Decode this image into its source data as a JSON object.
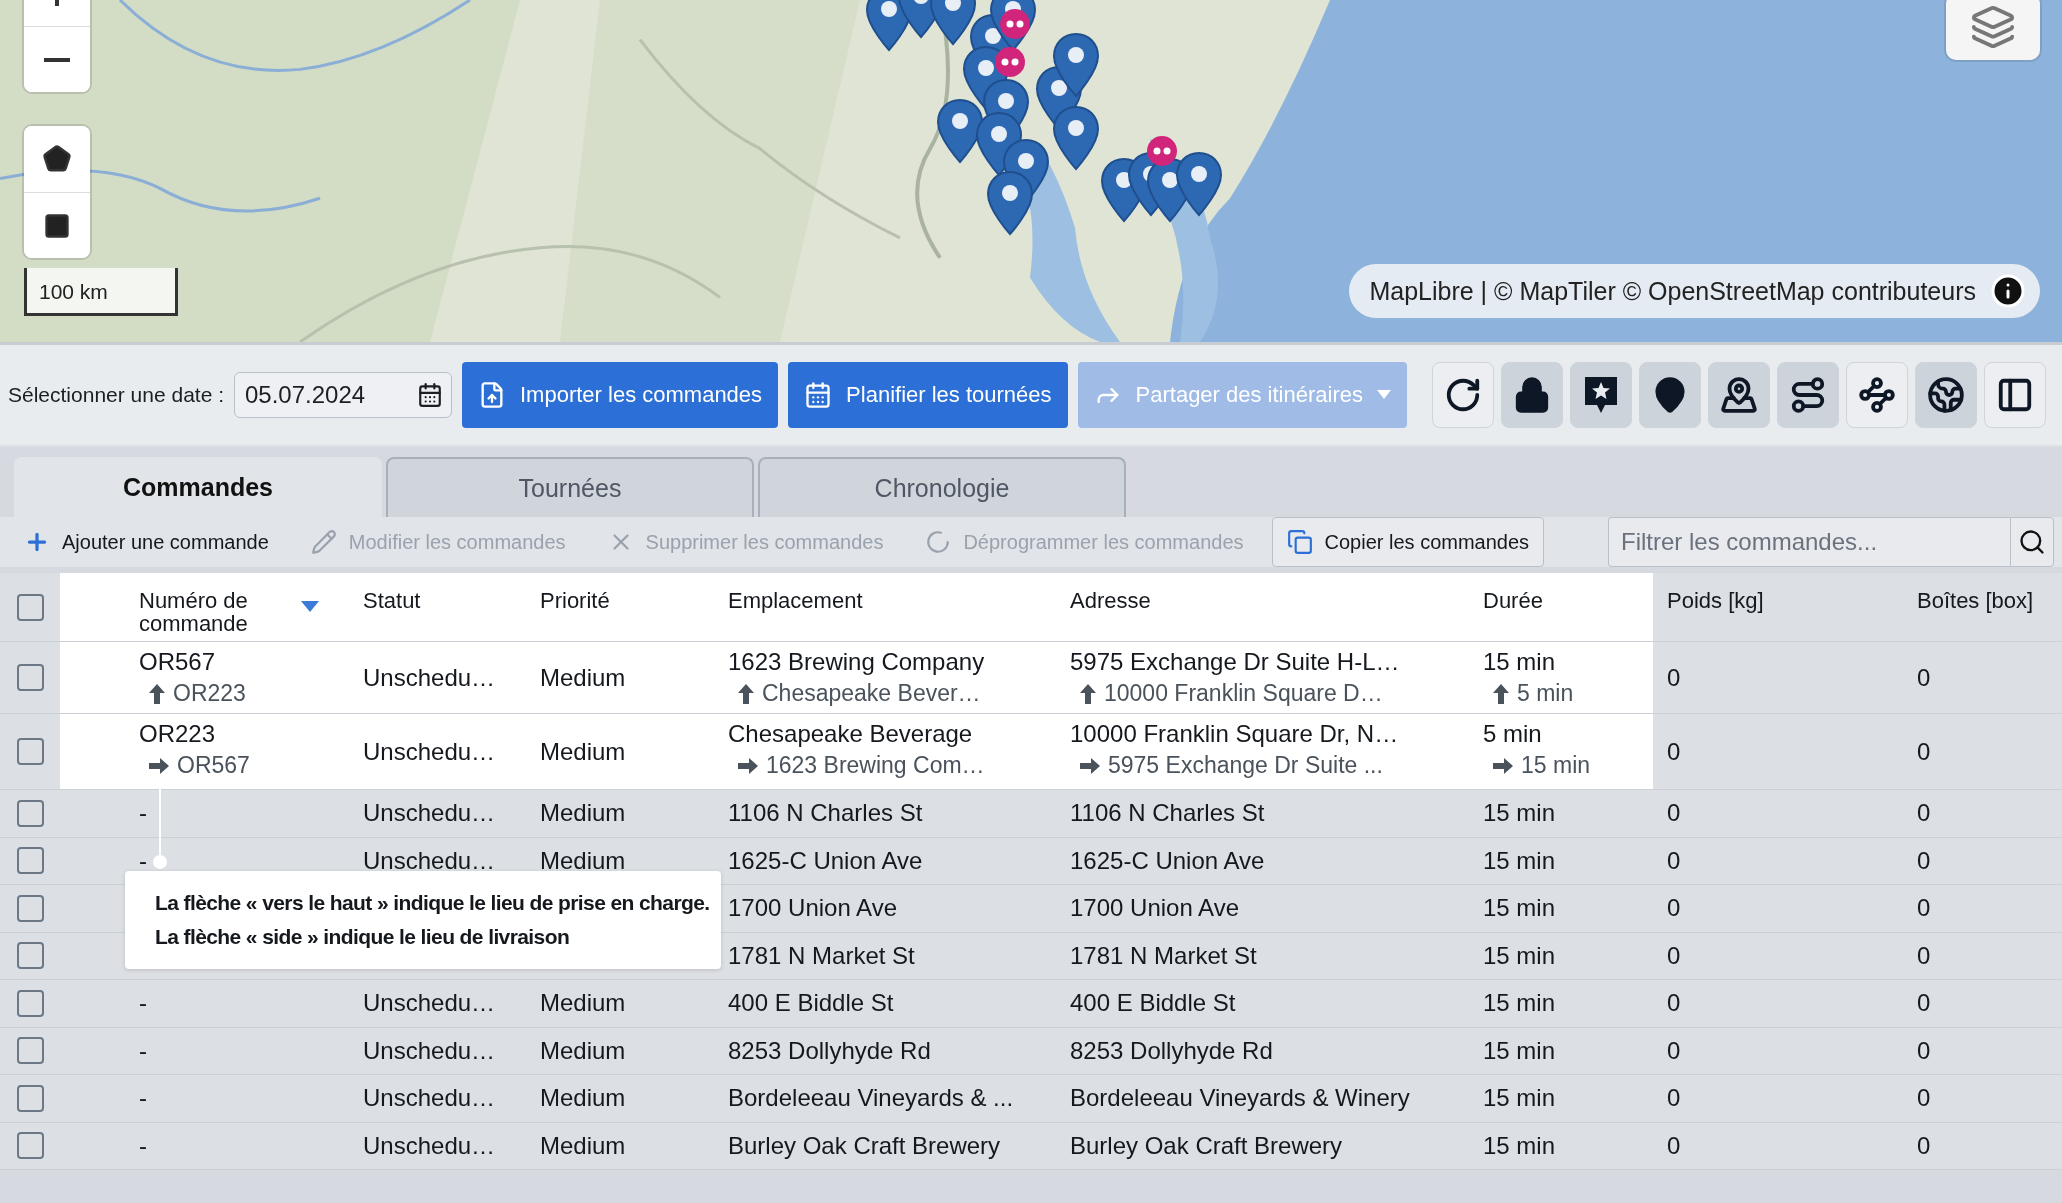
{
  "map": {
    "kind": "picture",
    "scale": "100 km",
    "attribution": "MapLibre | © MapTiler © OpenStreetMap contributeurs"
  },
  "toolbar": {
    "date_label": "Sélectionner une date :",
    "date_value": "05.07.2024",
    "buttons": [
      {
        "kind": "import",
        "label": "Importer les commandes",
        "disabled": false
      },
      {
        "kind": "plan",
        "label": "Planifier les tournées",
        "disabled": false
      },
      {
        "kind": "share",
        "label": "Partager des itinéraires",
        "disabled": true
      }
    ],
    "icon_buttons": [
      {
        "kind": "refresh",
        "active": false
      },
      {
        "kind": "lock",
        "active": true
      },
      {
        "kind": "star-bubble",
        "active": true
      },
      {
        "kind": "pin",
        "active": true
      },
      {
        "kind": "pin-base",
        "active": true
      },
      {
        "kind": "route",
        "active": true
      },
      {
        "kind": "branches",
        "active": false
      },
      {
        "kind": "globe",
        "active": true
      },
      {
        "kind": "panel",
        "active": false
      }
    ]
  },
  "tabs": [
    {
      "label": "Commandes",
      "selected": true
    },
    {
      "label": "Tournées",
      "selected": false
    },
    {
      "label": "Chronologie",
      "selected": false
    }
  ],
  "actions": [
    {
      "kind": "add",
      "label": "Ajouter une commande",
      "disabled": false
    },
    {
      "kind": "edit",
      "label": "Modifier les commandes",
      "disabled": true
    },
    {
      "kind": "delete",
      "label": "Supprimer les commandes",
      "disabled": true
    },
    {
      "kind": "unschedule",
      "label": "Déprogrammer les commandes",
      "disabled": true
    },
    {
      "kind": "copy",
      "label": "Copier les commandes",
      "disabled": false
    }
  ],
  "filter": {
    "placeholder": "Filtrer les commandes..."
  },
  "table": {
    "header_checked": false,
    "header_highlighted": true,
    "columns": [
      {
        "label": "Numéro de commande",
        "sorted": true
      },
      {
        "label": "Statut",
        "sorted": false
      },
      {
        "label": "Priorité",
        "sorted": false
      },
      {
        "label": "Emplacement",
        "sorted": false
      },
      {
        "label": "Adresse",
        "sorted": false
      },
      {
        "label": "Durée",
        "sorted": false
      },
      {
        "label": "Poids [kg]",
        "sorted": false
      },
      {
        "label": "Boîtes [box]",
        "sorted": false
      }
    ],
    "rows": [
      {
        "checked": false,
        "highlighted": true,
        "number": {
          "text": "OR567",
          "sub": {
            "kind": "up",
            "text": "OR223"
          }
        },
        "status": {
          "text": "Unschedu…"
        },
        "priority": {
          "text": "Medium"
        },
        "location": {
          "text": "1623 Brewing Company",
          "sub": {
            "kind": "up",
            "text": "Chesapeake Bever…"
          }
        },
        "address": {
          "text": "5975 Exchange Dr Suite H-L…",
          "sub": {
            "kind": "up",
            "text": "10000 Franklin Square D…"
          }
        },
        "duration": {
          "text": "15 min",
          "sub": {
            "kind": "up",
            "text": "5 min"
          }
        },
        "weight": {
          "text": "0"
        },
        "boxes": {
          "text": "0"
        }
      },
      {
        "checked": false,
        "highlighted": true,
        "number": {
          "text": "OR223",
          "sub": {
            "kind": "side",
            "text": "OR567"
          }
        },
        "status": {
          "text": "Unschedu…"
        },
        "priority": {
          "text": "Medium"
        },
        "location": {
          "text": "Chesapeake Beverage",
          "sub": {
            "kind": "side",
            "text": "1623 Brewing Com…"
          }
        },
        "address": {
          "text": "10000 Franklin Square Dr, N…",
          "sub": {
            "kind": "side",
            "text": "5975 Exchange Dr Suite ..."
          }
        },
        "duration": {
          "text": "5 min",
          "sub": {
            "kind": "side",
            "text": "15 min"
          }
        },
        "weight": {
          "text": "0"
        },
        "boxes": {
          "text": "0"
        }
      },
      {
        "checked": false,
        "highlighted": false,
        "number": {
          "text": "-"
        },
        "status": {
          "text": "Unschedu…"
        },
        "priority": {
          "text": "Medium"
        },
        "location": {
          "text": "1106 N Charles St"
        },
        "address": {
          "text": "1106 N Charles St"
        },
        "duration": {
          "text": "15 min"
        },
        "weight": {
          "text": "0"
        },
        "boxes": {
          "text": "0"
        }
      },
      {
        "checked": false,
        "highlighted": false,
        "number": {
          "text": "-"
        },
        "status": {
          "text": "Unschedu…"
        },
        "priority": {
          "text": "Medium"
        },
        "location": {
          "text": "1625-C Union Ave"
        },
        "address": {
          "text": "1625-C Union Ave"
        },
        "duration": {
          "text": "15 min"
        },
        "weight": {
          "text": "0"
        },
        "boxes": {
          "text": "0"
        }
      },
      {
        "checked": false,
        "highlighted": false,
        "location": {
          "text": "1700 Union Ave"
        },
        "address": {
          "text": "1700 Union Ave"
        },
        "duration": {
          "text": "15 min"
        },
        "weight": {
          "text": "0"
        },
        "boxes": {
          "text": "0"
        }
      },
      {
        "checked": false,
        "highlighted": false,
        "location": {
          "text": "1781 N Market St"
        },
        "address": {
          "text": "1781 N Market St"
        },
        "duration": {
          "text": "15 min"
        },
        "weight": {
          "text": "0"
        },
        "boxes": {
          "text": "0"
        }
      },
      {
        "checked": false,
        "highlighted": false,
        "number": {
          "text": "-"
        },
        "status": {
          "text": "Unschedu…"
        },
        "priority": {
          "text": "Medium"
        },
        "location": {
          "text": "400 E Biddle St"
        },
        "address": {
          "text": "400 E Biddle St"
        },
        "duration": {
          "text": "15 min"
        },
        "weight": {
          "text": "0"
        },
        "boxes": {
          "text": "0"
        }
      },
      {
        "checked": false,
        "highlighted": false,
        "number": {
          "text": "-"
        },
        "status": {
          "text": "Unschedu…"
        },
        "priority": {
          "text": "Medium"
        },
        "location": {
          "text": "8253 Dollyhyde Rd"
        },
        "address": {
          "text": "8253 Dollyhyde Rd"
        },
        "duration": {
          "text": "15 min"
        },
        "weight": {
          "text": "0"
        },
        "boxes": {
          "text": "0"
        }
      },
      {
        "checked": false,
        "highlighted": false,
        "number": {
          "text": "-"
        },
        "status": {
          "text": "Unschedu…"
        },
        "priority": {
          "text": "Medium"
        },
        "location": {
          "text": "Bordeleeau Vineyards & ..."
        },
        "address": {
          "text": "Bordeleeau Vineyards & Winery"
        },
        "duration": {
          "text": "15 min"
        },
        "weight": {
          "text": "0"
        },
        "boxes": {
          "text": "0"
        }
      },
      {
        "checked": false,
        "highlighted": false,
        "number": {
          "text": "-"
        },
        "status": {
          "text": "Unschedu…"
        },
        "priority": {
          "text": "Medium"
        },
        "location": {
          "text": "Burley Oak Craft Brewery"
        },
        "address": {
          "text": "Burley Oak Craft Brewery"
        },
        "duration": {
          "text": "15 min"
        },
        "weight": {
          "text": "0"
        },
        "boxes": {
          "text": "0"
        }
      }
    ]
  },
  "tooltip": {
    "lines": [
      "La flèche « vers le haut » indique le lieu de prise en charge.",
      "La flèche « side » indique le lieu de livraison"
    ]
  }
}
